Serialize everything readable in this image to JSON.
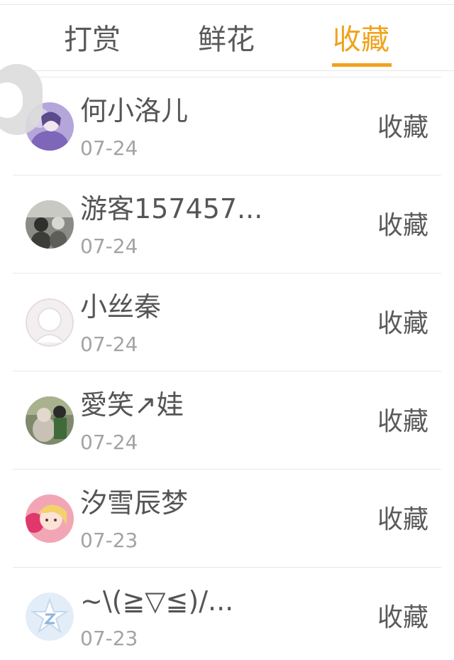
{
  "tabs": [
    {
      "label": "打赏"
    },
    {
      "label": "鲜花"
    },
    {
      "label": "收藏"
    }
  ],
  "active_tab": "收藏",
  "accent_color": "#f0a31c",
  "rows": [
    {
      "name": "何小洛儿",
      "date": "07-24",
      "action": "收藏",
      "avatar": "purple-photo"
    },
    {
      "name": "游客157457...",
      "date": "07-24",
      "action": "收藏",
      "avatar": "grayscale-photo"
    },
    {
      "name": "小丝秦",
      "date": "07-24",
      "action": "收藏",
      "avatar": "default-silhouette"
    },
    {
      "name": "愛笑↗娃",
      "date": "07-24",
      "action": "收藏",
      "avatar": "outdoor-photo"
    },
    {
      "name": "汐雪辰梦",
      "date": "07-23",
      "action": "收藏",
      "avatar": "pink-photo"
    },
    {
      "name": "~\\(≧▽≦)/...",
      "date": "07-23",
      "action": "收藏",
      "avatar": "star-logo"
    }
  ]
}
